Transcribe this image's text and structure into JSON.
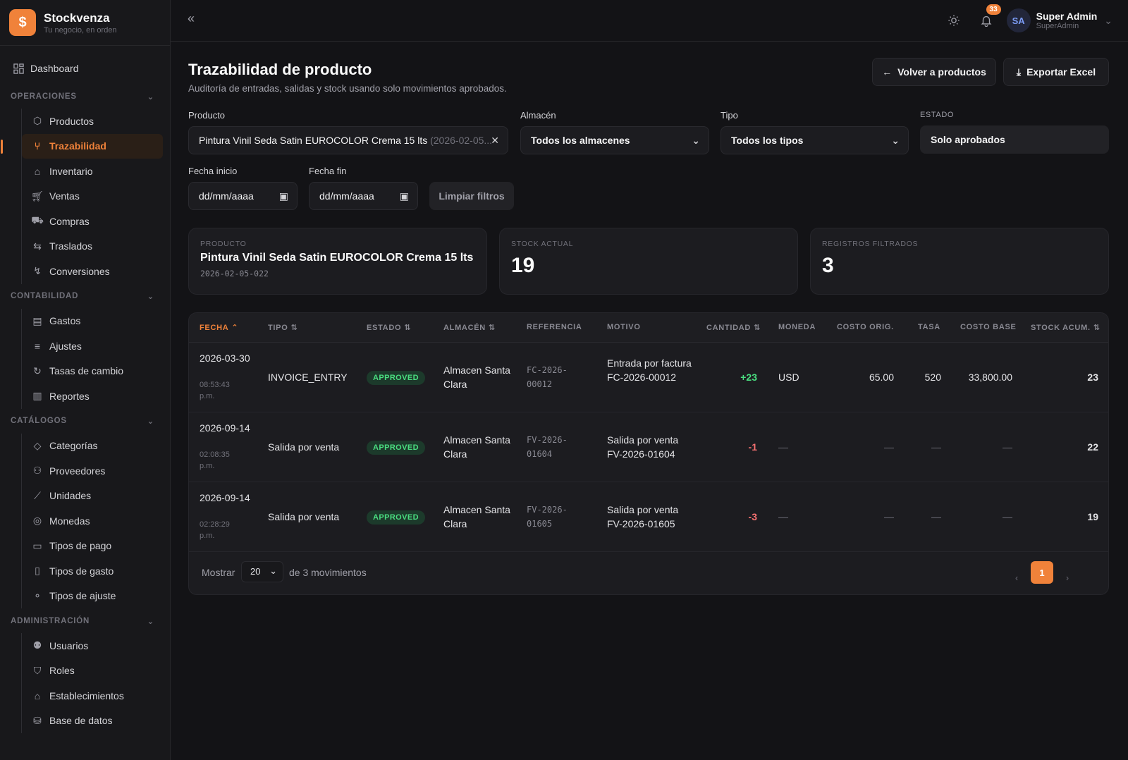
{
  "brand": {
    "name": "Stockvenza",
    "tagline": "Tu negocio, en orden"
  },
  "sidebar": {
    "dashboard": "Dashboard",
    "sections": [
      {
        "title": "OPERACIONES",
        "items": [
          "Productos",
          "Trazabilidad",
          "Inventario",
          "Ventas",
          "Compras",
          "Traslados",
          "Conversiones"
        ]
      },
      {
        "title": "CONTABILIDAD",
        "items": [
          "Gastos",
          "Ajustes",
          "Tasas de cambio",
          "Reportes"
        ]
      },
      {
        "title": "CATÁLOGOS",
        "items": [
          "Categorías",
          "Proveedores",
          "Unidades",
          "Monedas",
          "Tipos de pago",
          "Tipos de gasto",
          "Tipos de ajuste"
        ]
      },
      {
        "title": "ADMINISTRACIÓN",
        "items": [
          "Usuarios",
          "Roles",
          "Establecimientos",
          "Base de datos"
        ]
      }
    ],
    "active": "Trazabilidad"
  },
  "topbar": {
    "notifications": "33",
    "avatar_initials": "SA",
    "user_name": "Super Admin",
    "user_role": "SuperAdmin"
  },
  "page": {
    "title": "Trazabilidad de producto",
    "subtitle": "Auditoría de entradas, salidas y stock usando solo movimientos aprobados.",
    "back_button": "Volver a productos",
    "export_button": "Exportar Excel"
  },
  "filters": {
    "product_label": "Producto",
    "product_value": "Pintura Vinil Seda Satin EUROCOLOR Crema 15 lts",
    "product_code_hint": "(2026-02-05...",
    "warehouse_label": "Almacén",
    "warehouse_value": "Todos los almacenes",
    "type_label": "Tipo",
    "type_value": "Todos los tipos",
    "status_label": "ESTADO",
    "status_value": "Solo aprobados",
    "start_label": "Fecha inicio",
    "start_placeholder": "dd/mm/aaaa",
    "end_label": "Fecha fin",
    "end_placeholder": "dd/mm/aaaa",
    "clear_button": "Limpiar filtros"
  },
  "summary": {
    "product_label": "PRODUCTO",
    "product_name": "Pintura Vinil Seda Satin EUROCOLOR Crema 15 lts",
    "product_code": "2026-02-05-022",
    "stock_label": "STOCK ACTUAL",
    "stock_value": "19",
    "records_label": "REGISTROS FILTRADOS",
    "records_value": "3"
  },
  "table": {
    "columns": [
      "FECHA",
      "TIPO",
      "ESTADO",
      "ALMACÉN",
      "REFERENCIA",
      "MOTIVO",
      "CANTIDAD",
      "MONEDA",
      "COSTO ORIG.",
      "TASA",
      "COSTO BASE",
      "STOCK ACUM."
    ],
    "rows": [
      {
        "date": "2026-03-30",
        "time": "08:53:43 p.m.",
        "type": "INVOICE_ENTRY",
        "status": "APPROVED",
        "warehouse": "Almacen Santa Clara",
        "reference": "FC-2026-00012",
        "reason": "Entrada por factura FC-2026-00012",
        "qty": "+23",
        "currency": "USD",
        "orig_cost": "65.00",
        "rate": "520",
        "base_cost": "33,800.00",
        "stock": "23"
      },
      {
        "date": "2026-09-14",
        "time": "02:08:35 p.m.",
        "type": "Salida por venta",
        "status": "APPROVED",
        "warehouse": "Almacen Santa Clara",
        "reference": "FV-2026-01604",
        "reason": "Salida por venta FV-2026-01604",
        "qty": "-1",
        "currency": "—",
        "orig_cost": "—",
        "rate": "—",
        "base_cost": "—",
        "stock": "22"
      },
      {
        "date": "2026-09-14",
        "time": "02:28:29 p.m.",
        "type": "Salida por venta",
        "status": "APPROVED",
        "warehouse": "Almacen Santa Clara",
        "reference": "FV-2026-01605",
        "reason": "Salida por venta FV-2026-01605",
        "qty": "-3",
        "currency": "—",
        "orig_cost": "—",
        "rate": "—",
        "base_cost": "—",
        "stock": "19"
      }
    ],
    "show_label": "Mostrar",
    "page_size": "20",
    "total_label": "de 3 movimientos",
    "current_page": "1"
  },
  "colors": {
    "accent": "#f0823a",
    "positive": "#4ade80",
    "negative": "#f87171",
    "background": "#131316"
  }
}
